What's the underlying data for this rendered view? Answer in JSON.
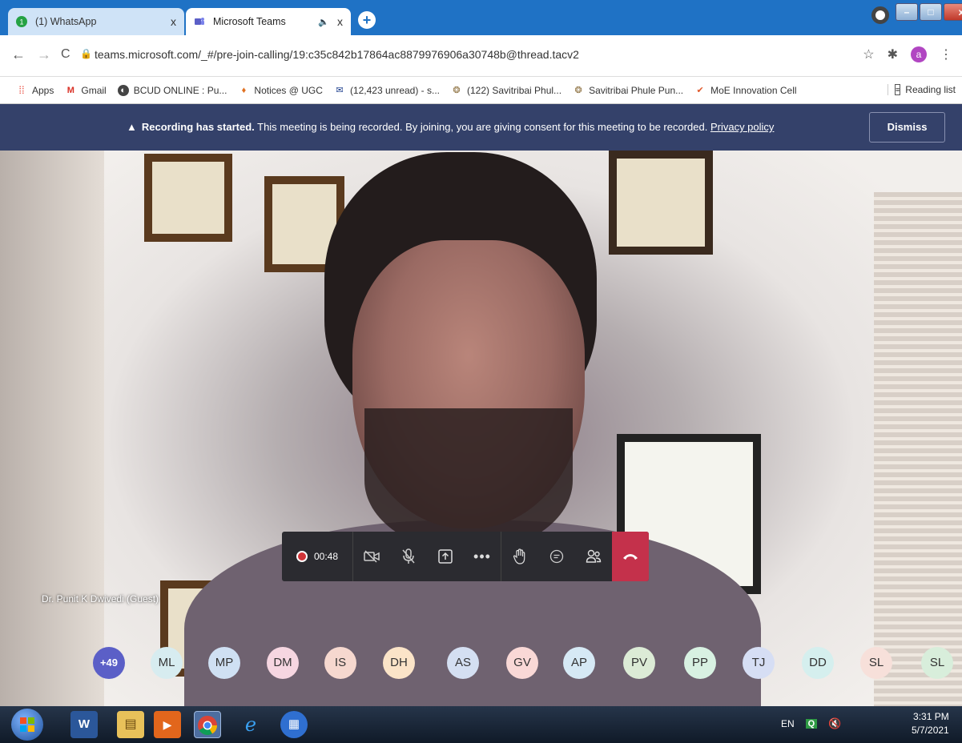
{
  "browser": {
    "tabs": [
      {
        "title": "(1) WhatsApp",
        "close": "x"
      },
      {
        "title": "Microsoft Teams",
        "close": "x",
        "audio": "🔈"
      }
    ],
    "new_tab": "+",
    "win_buttons": {
      "minimize": "–",
      "maximize": "□",
      "close": "x"
    },
    "url": "teams.microsoft.com/_#/pre-join-calling/19:c35c842b17864ac8879976906a30748b@thread.tacv2",
    "avatar_letter": "a",
    "bookmarks": [
      {
        "label": "Apps",
        "icon": "apps-grid-icon"
      },
      {
        "label": "Gmail",
        "icon": "gmail-icon"
      },
      {
        "label": "BCUD ONLINE : Pu...",
        "icon": "globe-icon"
      },
      {
        "label": "Notices @ UGC",
        "icon": "ugc-icon"
      },
      {
        "label": "(12,423 unread) - s...",
        "icon": "mail-icon"
      },
      {
        "label": "(122) Savitribai Phul...",
        "icon": "university-icon"
      },
      {
        "label": "Savitribai Phule Pun...",
        "icon": "university-icon"
      },
      {
        "label": "MoE Innovation Cell",
        "icon": "moe-icon"
      }
    ],
    "reading_list": "Reading list"
  },
  "teams": {
    "banner": {
      "bold": "Recording has started.",
      "text": " This meeting is being recorded. By joining, you are giving consent for this meeting to be recorded. ",
      "link": "Privacy policy",
      "dismiss": "Dismiss"
    },
    "call_timer": "00:48",
    "participant_name": "Dr. Punit K Dwivedi (Guest)",
    "participants": [
      {
        "initials": "+49",
        "color": "#5b5fc7"
      },
      {
        "initials": "ML",
        "color": "#d7ecf0"
      },
      {
        "initials": "MP",
        "color": "#cfe0f3"
      },
      {
        "initials": "DM",
        "color": "#f6d6e1"
      },
      {
        "initials": "IS",
        "color": "#f6d8cf"
      },
      {
        "initials": "DH",
        "color": "#fbe4c8"
      },
      {
        "initials": "AS",
        "color": "#d4dff2"
      },
      {
        "initials": "GV",
        "color": "#f9d8d6"
      },
      {
        "initials": "AP",
        "color": "#d6e9f5"
      },
      {
        "initials": "PV",
        "color": "#dcebd6"
      },
      {
        "initials": "PP",
        "color": "#d8f1e2"
      },
      {
        "initials": "TJ",
        "color": "#d6def4"
      },
      {
        "initials": "DD",
        "color": "#d5efee"
      },
      {
        "initials": "SL",
        "color": "#f7e0da"
      },
      {
        "initials": "SL",
        "color": "#d8eedb"
      }
    ]
  },
  "taskbar": {
    "language": "EN",
    "time": "3:31 PM",
    "date": "5/7/2021"
  }
}
